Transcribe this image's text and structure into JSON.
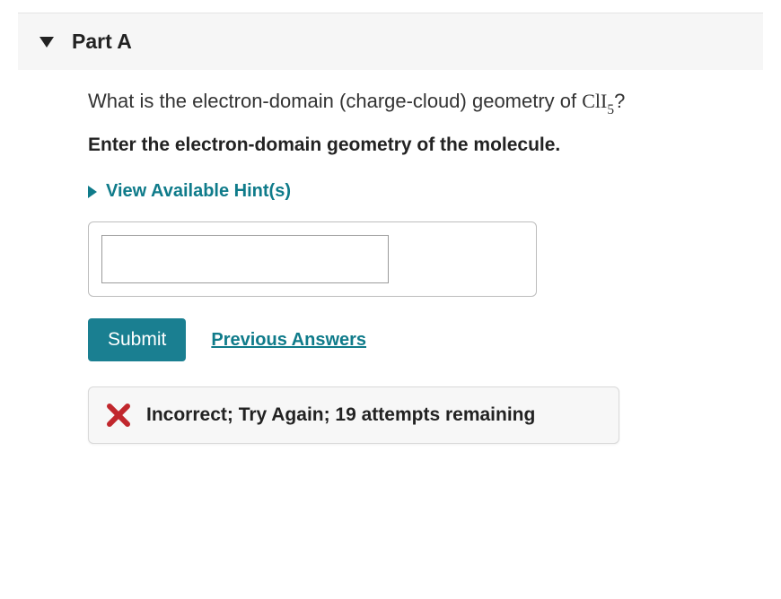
{
  "part": {
    "title": "Part A"
  },
  "question": {
    "prefix": "What is the electron-domain (charge-cloud) geometry of ",
    "formula_base": "ClI",
    "formula_sub": "5",
    "suffix": "?"
  },
  "instruction": "Enter the electron-domain geometry of the molecule.",
  "hints": {
    "label": "View Available Hint(s)"
  },
  "answer": {
    "value": ""
  },
  "buttons": {
    "submit": "Submit",
    "previous_answers": "Previous Answers"
  },
  "feedback": {
    "text": "Incorrect; Try Again; 19 attempts remaining"
  }
}
